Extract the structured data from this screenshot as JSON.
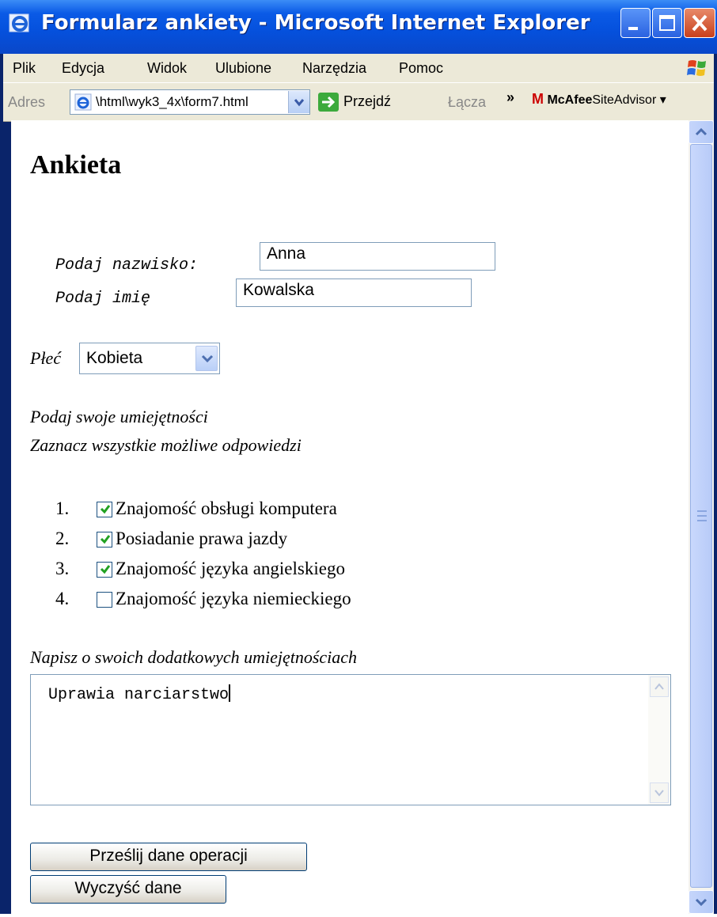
{
  "window": {
    "title": "Formularz ankiety - Microsoft Internet Explorer"
  },
  "menu": [
    "Plik",
    "Edycja",
    "Widok",
    "Ulubione",
    "Narzędzia",
    "Pomoc"
  ],
  "address": {
    "label": "Adres",
    "value": "\\html\\wyk3_4x\\form7.html",
    "go_label": "Przejdź",
    "links_label": "Łącza",
    "chevron": "»"
  },
  "mcafee": {
    "logo": "M",
    "brand": "McAfee",
    "product": "SiteAdvisor",
    "dropdown": "▾"
  },
  "page": {
    "heading": "Ankieta",
    "surname_label": "Podaj nazwisko:",
    "surname_value": "Anna",
    "name_label": "Podaj imię",
    "name_value": "Kowalska",
    "gender_label": "Płeć",
    "gender_value": "Kobieta",
    "skills_prompt_1": "Podaj swoje umiejętności",
    "skills_prompt_2": "Zaznacz wszystkie możliwe odpowiedzi",
    "skills": [
      {
        "num": "1.",
        "label": "Znajomość obsługi komputera",
        "checked": true
      },
      {
        "num": "2.",
        "label": "Posiadanie prawa jazdy",
        "checked": true
      },
      {
        "num": "3.",
        "label": "Znajomość języka angielskiego",
        "checked": true
      },
      {
        "num": "4.",
        "label": "Znajomość języka niemieckiego",
        "checked": false
      }
    ],
    "extra_label": "Napisz o swoich dodatkowych umiejętnościach",
    "extra_value": "Uprawia narciarstwo",
    "submit_label": "Prześlij dane operacji",
    "reset_label": "Wyczyść dane"
  },
  "colors": {
    "titlebar": "#0550dc",
    "chrome": "#ece9d8",
    "check": "#21a121"
  }
}
